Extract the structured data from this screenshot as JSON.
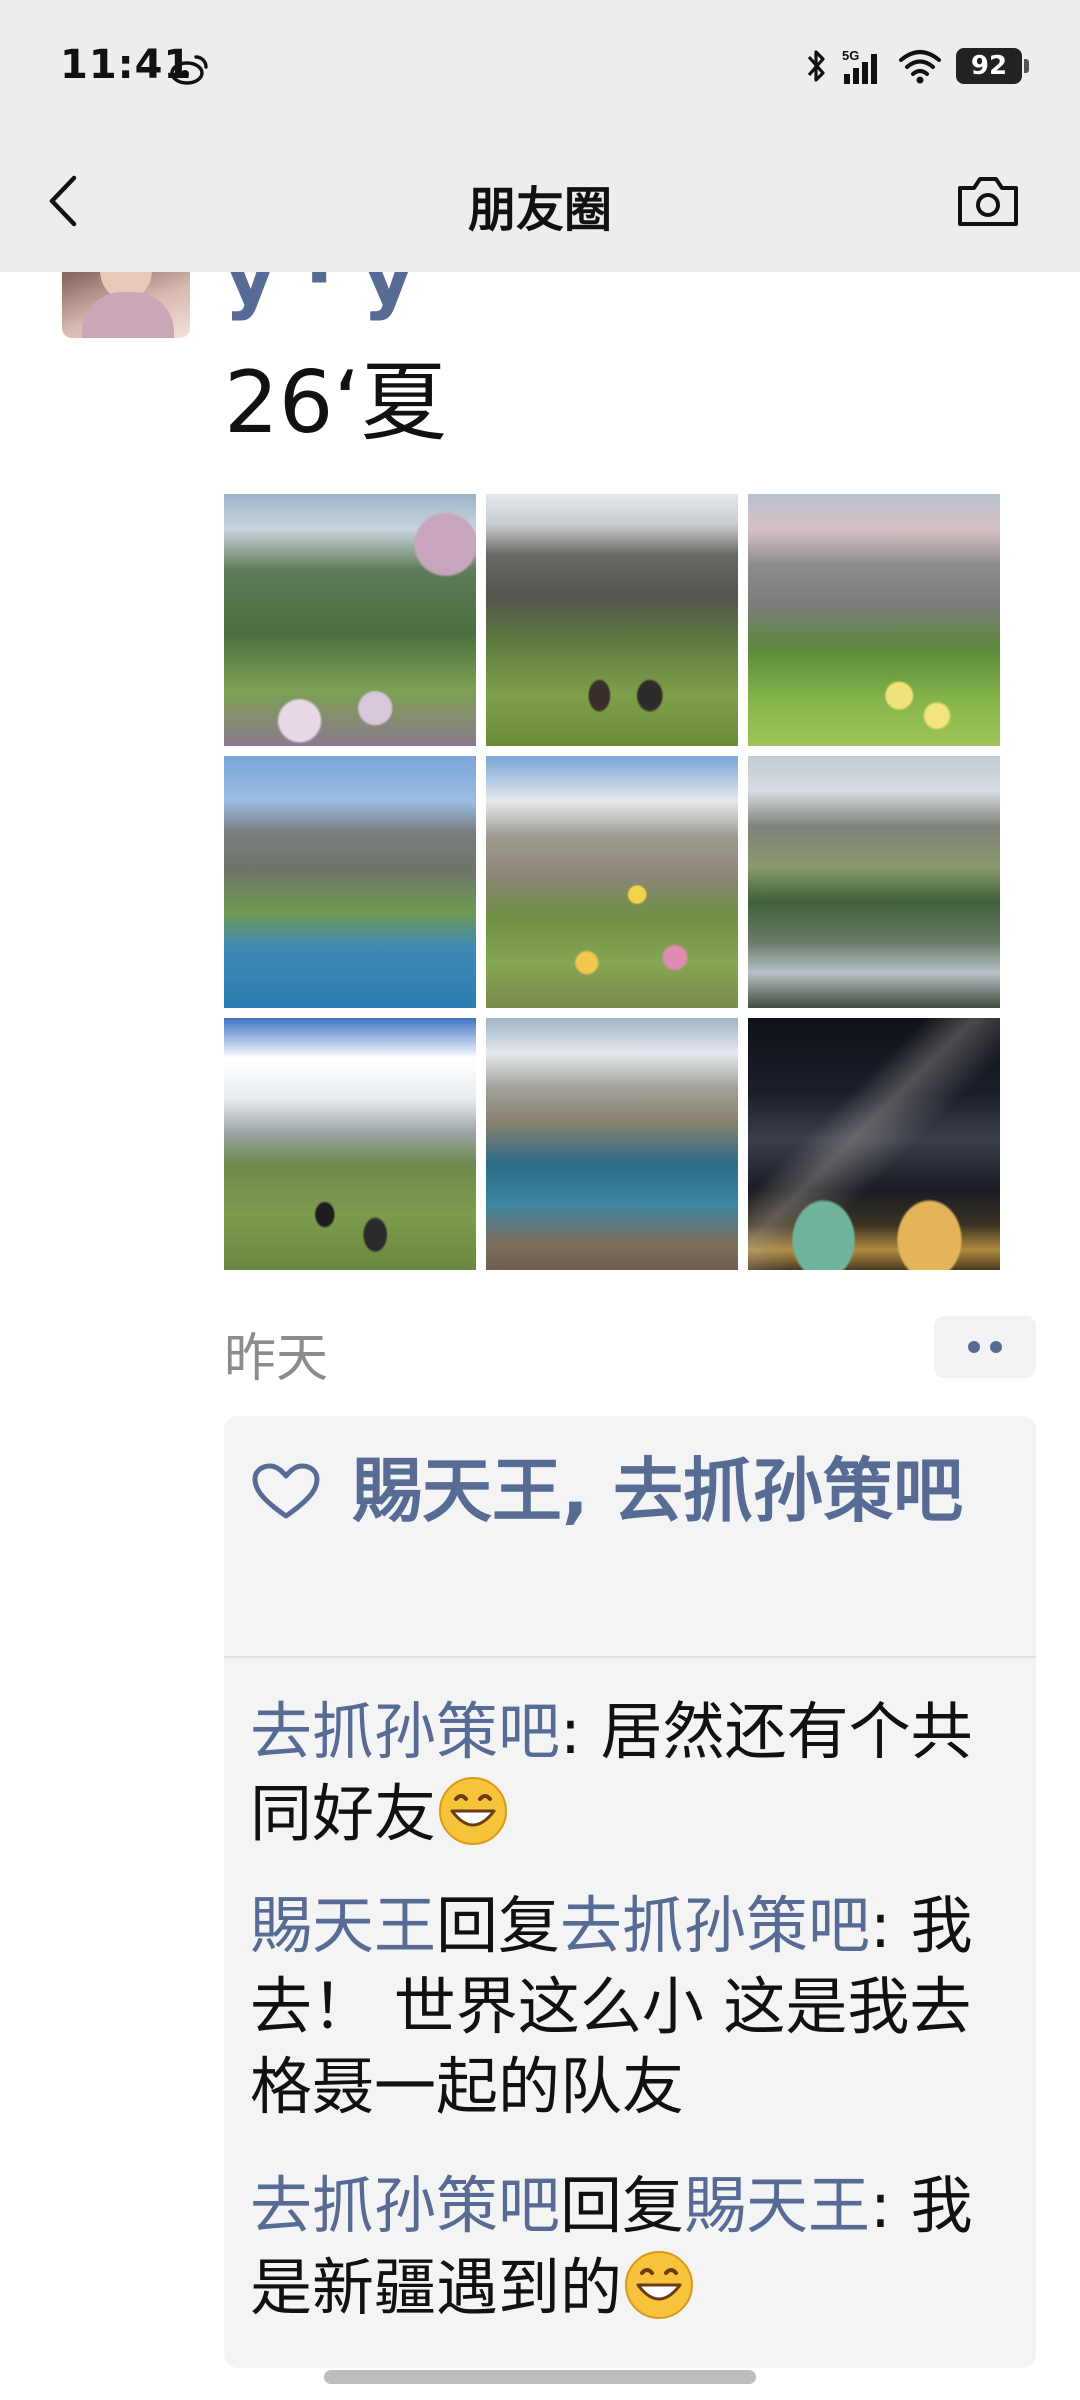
{
  "status_bar": {
    "time": "11:41",
    "network": "5G",
    "battery": "92"
  },
  "nav": {
    "title": "朋友圈"
  },
  "post": {
    "username": "y · y",
    "text": "26‘夏",
    "photos": [
      "meadow-flowers-mountains",
      "hikers-rocky-peaks",
      "green-slopes-peaks",
      "alpine-lake-valley",
      "wildflowers-jagged-peaks",
      "mirror-lake-reflection",
      "hikers-clouds-meadow",
      "turquoise-lake-snow-peaks",
      "milky-way-tents"
    ],
    "timestamp": "昨天"
  },
  "likes": {
    "text": "賜天王, 去抓孙策吧"
  },
  "comments": [
    {
      "author": "去抓孙策吧",
      "reply_to": "",
      "text": ": 居然还有个共同好友"
    },
    {
      "author": "賜天王",
      "reply_word": "回复",
      "reply_to": "去抓孙策吧",
      "text": ": 我去！ 世界这么小 这是我去格聂一起的队友"
    },
    {
      "author": "去抓孙策吧",
      "reply_word": "回复",
      "reply_to": "賜天王",
      "text": ": 我是新疆遇到的"
    }
  ],
  "colors": {
    "link": "#576b95",
    "header_bg": "#ededed",
    "comment_bg": "#f4f4f4"
  },
  "icons": [
    "weibo-icon",
    "bluetooth-icon",
    "signal-icon",
    "wifi-icon",
    "back-icon",
    "camera-icon",
    "heart-icon",
    "grin-emoji-icon"
  ]
}
